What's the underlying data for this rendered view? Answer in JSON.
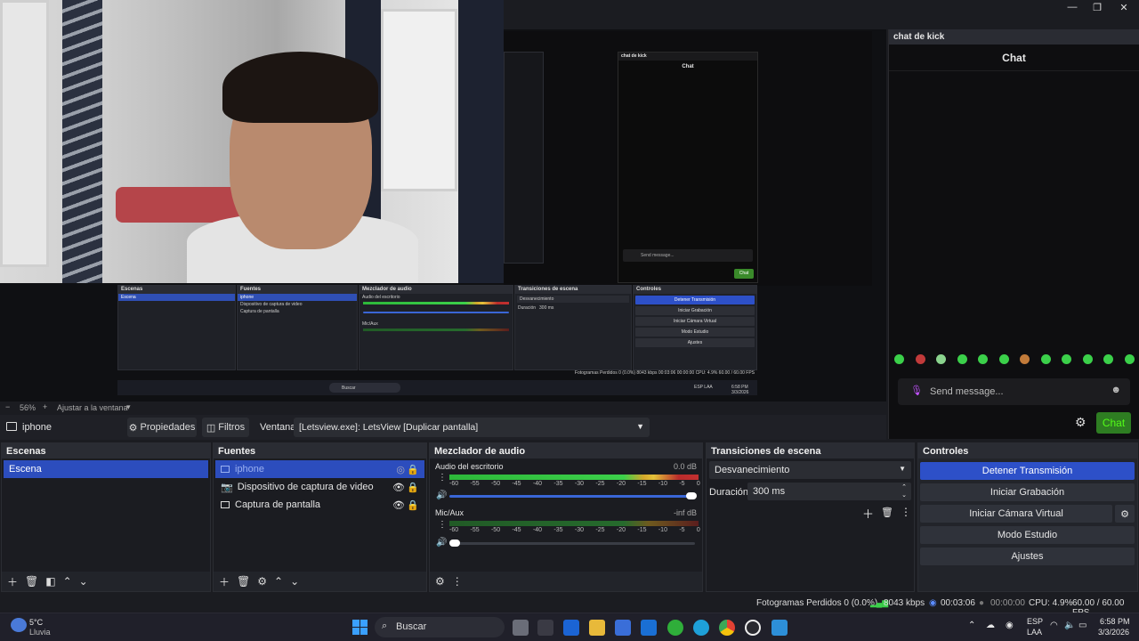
{
  "window": {
    "min": "—",
    "max": "❐",
    "close": "✕"
  },
  "nested": {
    "scenes_title": "Escenas",
    "scene": "Escena",
    "sources_title": "Fuentes",
    "source_selected": "iphone",
    "sources": [
      "Dispositivo de captura de video",
      "Captura de pantalla"
    ],
    "mixer_title": "Mezclador de audio",
    "desktop_audio": "Audio del escritorio",
    "mic": "Mic/Aux",
    "transitions_title": "Transiciones de escena",
    "transition": "Desvanecimiento",
    "duration_label": "Duración",
    "duration": "300 ms",
    "controls_title": "Controles",
    "controls": [
      "Detener Transmisión",
      "Iniciar Grabación",
      "Iniciar Cámara Virtual",
      "Modo Estudio",
      "Ajustes"
    ],
    "status": "Fotogramas Perdidos 0 (0.0%)   8043 kbps   00:03:06   00:00:00   CPU: 4.9%   60.00 / 60.00 FPS",
    "search": "Buscar",
    "chat_title": "chat de kick",
    "chat_header": "Chat",
    "chat_placeholder": "Send message...",
    "chat_send": "Chat",
    "tray": "ESP LAA",
    "clock": "6:58 PM 3/3/2026"
  },
  "zoom": {
    "minus": "−",
    "percent": "56%",
    "plus": "+",
    "fit": "Ajustar a la ventana",
    "caret": "▾"
  },
  "source_toolbar": {
    "source_name": "iphone",
    "properties": "Propiedades",
    "filters": "Filtros",
    "window_label": "Ventana",
    "window_value": "[Letsview.exe]: LetsView [Duplicar pantalla]"
  },
  "scenes": {
    "title": "Escenas",
    "items": [
      "Escena"
    ]
  },
  "sources": {
    "title": "Fuentes",
    "items": [
      {
        "label": "iphone",
        "icon": "window-icon"
      },
      {
        "label": "Dispositivo de captura de video",
        "icon": "camera-icon"
      },
      {
        "label": "Captura de pantalla",
        "icon": "monitor-icon"
      }
    ]
  },
  "mixer": {
    "title": "Mezclador de audio",
    "desktop": {
      "label": "Audio del escritorio",
      "db": "0.0 dB",
      "volume": 1.0
    },
    "mic": {
      "label": "Mic/Aux",
      "db": "-inf dB",
      "volume": 0.05
    },
    "ticks": [
      "-60",
      "-55",
      "-50",
      "-45",
      "-40",
      "-35",
      "-30",
      "-25",
      "-20",
      "-15",
      "-10",
      "-5",
      "0"
    ]
  },
  "transitions": {
    "title": "Transiciones de escena",
    "selected": "Desvanecimiento",
    "duration_label": "Duración",
    "duration_value": "300 ms"
  },
  "controls": {
    "title": "Controles",
    "stop_stream": "Detener Transmisión",
    "start_recording": "Iniciar Grabación",
    "virtual_cam": "Iniciar Cámara Virtual",
    "studio_mode": "Modo Estudio",
    "settings": "Ajustes"
  },
  "statusbar": {
    "dropped": "Fotogramas Perdidos 0 (0.0%)",
    "bitrate": "8043 kbps",
    "stream_time": "00:03:06",
    "rec_time": "00:00:00",
    "cpu": "CPU: 4.9%",
    "fps": "60.00 / 60.00 FPS"
  },
  "chat": {
    "title": "chat de kick",
    "header": "Chat",
    "placeholder": "Send message...",
    "send_label": "Chat"
  },
  "taskbar": {
    "weather_temp": "5°C",
    "weather_desc": "Lluvia",
    "search": "Buscar",
    "lang1": "ESP",
    "lang2": "LAA",
    "time": "6:58 PM",
    "date": "3/3/2026"
  },
  "colors": {
    "accent": "#2d50c8",
    "kick_green": "#53fc18",
    "bg": "#1b1c21"
  }
}
